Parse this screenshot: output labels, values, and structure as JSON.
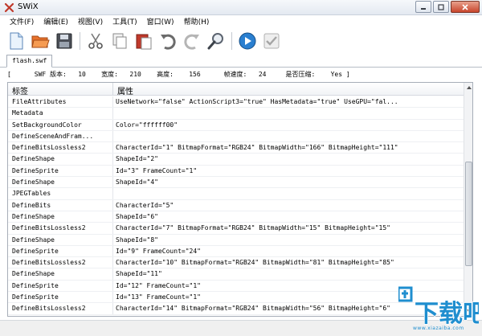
{
  "window": {
    "title": "SWiX",
    "minimize_icon": "minimize-icon",
    "maximize_icon": "maximize-icon",
    "close_icon": "close-icon"
  },
  "menu": [
    {
      "label": "文件(F)"
    },
    {
      "label": "编辑(E)"
    },
    {
      "label": "视图(V)"
    },
    {
      "label": "工具(T)"
    },
    {
      "label": "窗口(W)"
    },
    {
      "label": "帮助(H)"
    }
  ],
  "toolbar": {
    "icons": [
      "new-file-icon",
      "open-folder-icon",
      "save-icon",
      "cut-icon",
      "copy-icon",
      "paste-icon",
      "undo-icon",
      "redo-icon",
      "search-icon",
      "play-icon",
      "check-icon"
    ]
  },
  "tab": {
    "label": "flash.swf"
  },
  "info": {
    "text": "[      SWF 版本:   10    宽度:   210    高度:    156      帧速度:   24     是否压缩:    Yes ]"
  },
  "grid": {
    "headers": [
      "标签",
      "属性"
    ],
    "rows": [
      {
        "tag": "FileAttributes",
        "attr": "UseNetwork=\"false\" ActionScript3=\"true\" HasMetadata=\"true\" UseGPU=\"fal..."
      },
      {
        "tag": "Metadata",
        "attr": ""
      },
      {
        "tag": "SetBackgroundColor",
        "attr": "Color=\"ffffff00\""
      },
      {
        "tag": "DefineSceneAndFram...",
        "attr": ""
      },
      {
        "tag": "DefineBitsLossless2",
        "attr": "CharacterId=\"1\" BitmapFormat=\"RGB24\" BitmapWidth=\"166\" BitmapHeight=\"111\""
      },
      {
        "tag": "DefineShape",
        "attr": "ShapeId=\"2\""
      },
      {
        "tag": "DefineSprite",
        "attr": "Id=\"3\" FrameCount=\"1\""
      },
      {
        "tag": "DefineShape",
        "attr": "ShapeId=\"4\""
      },
      {
        "tag": "JPEGTables",
        "attr": ""
      },
      {
        "tag": "DefineBits",
        "attr": "CharacterId=\"5\""
      },
      {
        "tag": "DefineShape",
        "attr": "ShapeId=\"6\""
      },
      {
        "tag": "DefineBitsLossless2",
        "attr": "CharacterId=\"7\" BitmapFormat=\"RGB24\" BitmapWidth=\"15\" BitmapHeight=\"15\""
      },
      {
        "tag": "DefineShape",
        "attr": "ShapeId=\"8\""
      },
      {
        "tag": "DefineSprite",
        "attr": "Id=\"9\" FrameCount=\"24\""
      },
      {
        "tag": "DefineBitsLossless2",
        "attr": "CharacterId=\"10\" BitmapFormat=\"RGB24\" BitmapWidth=\"81\" BitmapHeight=\"85\""
      },
      {
        "tag": "DefineShape",
        "attr": "ShapeId=\"11\""
      },
      {
        "tag": "DefineSprite",
        "attr": "Id=\"12\" FrameCount=\"1\""
      },
      {
        "tag": "DefineSprite",
        "attr": "Id=\"13\" FrameCount=\"1\""
      },
      {
        "tag": "DefineBitsLossless2",
        "attr": "CharacterId=\"14\" BitmapFormat=\"RGB24\" BitmapWidth=\"56\" BitmapHeight=\"6\""
      }
    ]
  },
  "watermark": {
    "text": "下载吧",
    "url": "www.xiazaiba.com"
  },
  "colors": {
    "accent": "#2a7fd0",
    "watermark": "#1f8ecf"
  }
}
